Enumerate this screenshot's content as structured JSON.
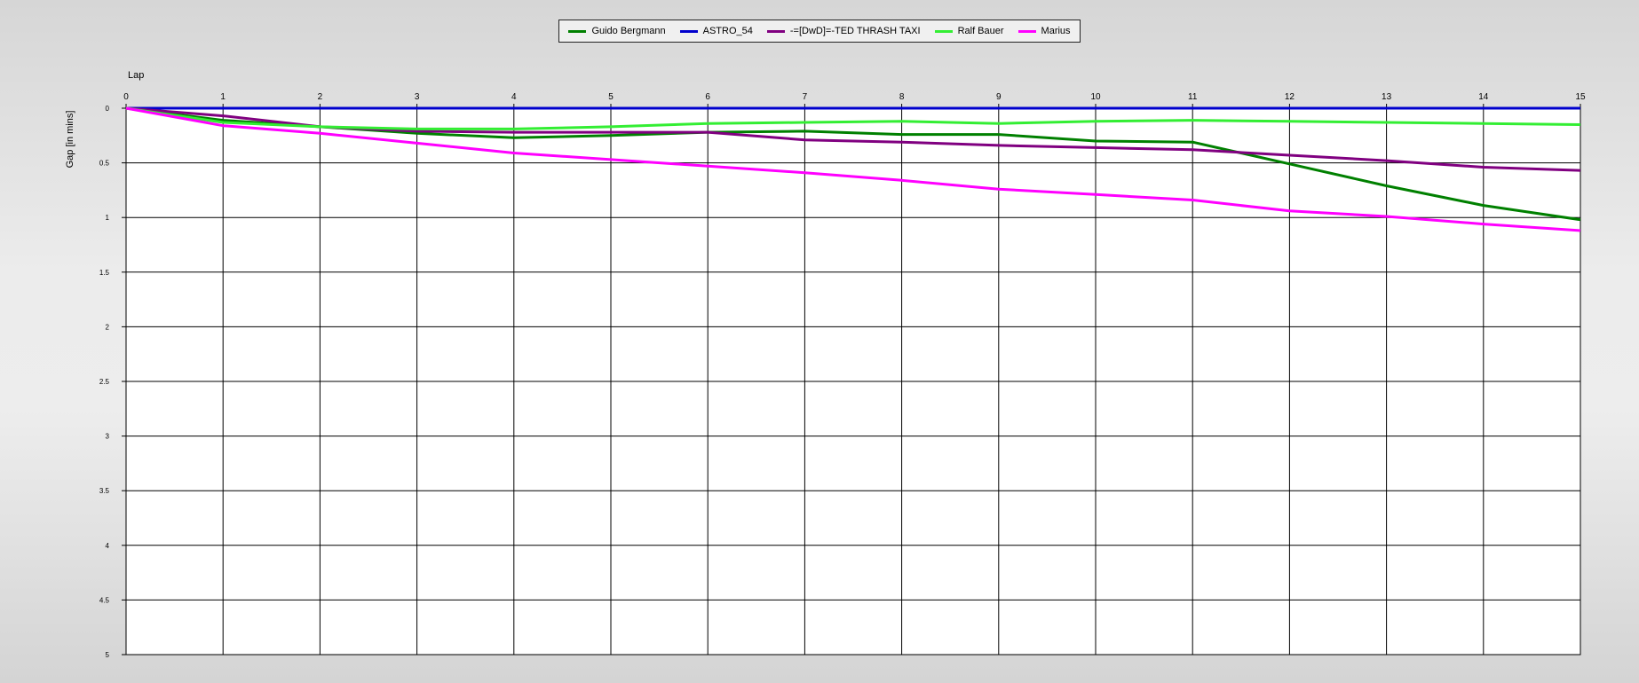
{
  "chart_data": {
    "type": "line",
    "xlabel": "Lap",
    "ylabel": "Gap [in mins]",
    "xlim": [
      0,
      15
    ],
    "ylim": [
      0,
      5
    ],
    "y_inverted": true,
    "x_axis_position": "top",
    "grid": true,
    "legend_position": "top-center",
    "x_ticks": [
      "0",
      "1",
      "2",
      "3",
      "4",
      "5",
      "6",
      "7",
      "8",
      "9",
      "10",
      "11",
      "12",
      "13",
      "14",
      "15"
    ],
    "y_ticks": [
      "0",
      "0.5",
      "1",
      "1.5",
      "2",
      "2.5",
      "3",
      "3.5",
      "4",
      "4.5",
      "5"
    ],
    "x": [
      0,
      1,
      2,
      3,
      4,
      5,
      6,
      7,
      8,
      9,
      10,
      11,
      12,
      13,
      14,
      15
    ],
    "series": [
      {
        "name": "Guido Bergmann",
        "color": "#008000",
        "values": [
          0,
          0.11,
          0.17,
          0.23,
          0.27,
          0.25,
          0.22,
          0.21,
          0.24,
          0.24,
          0.3,
          0.31,
          0.51,
          0.71,
          0.89,
          1.02
        ]
      },
      {
        "name": "ASTRO_54",
        "color": "#0000cd",
        "values": [
          0,
          0,
          0,
          0,
          0,
          0,
          0,
          0,
          0,
          0,
          0,
          0,
          0,
          0,
          0,
          0
        ]
      },
      {
        "name": "-=[DwD]=-TED THRASH TAXI",
        "color": "#800080",
        "values": [
          0,
          0.07,
          0.17,
          0.21,
          0.22,
          0.22,
          0.22,
          0.29,
          0.31,
          0.34,
          0.36,
          0.38,
          0.43,
          0.48,
          0.54,
          0.57
        ]
      },
      {
        "name": "Ralf Bauer",
        "color": "#33ee33",
        "values": [
          0,
          0.13,
          0.17,
          0.19,
          0.19,
          0.17,
          0.14,
          0.13,
          0.12,
          0.14,
          0.12,
          0.11,
          0.12,
          0.13,
          0.14,
          0.15
        ]
      },
      {
        "name": "Marius",
        "color": "#ff00ff",
        "values": [
          0,
          0.16,
          0.23,
          0.32,
          0.41,
          0.47,
          0.53,
          0.59,
          0.66,
          0.74,
          0.79,
          0.84,
          0.94,
          0.99,
          1.06,
          1.12
        ]
      }
    ]
  }
}
